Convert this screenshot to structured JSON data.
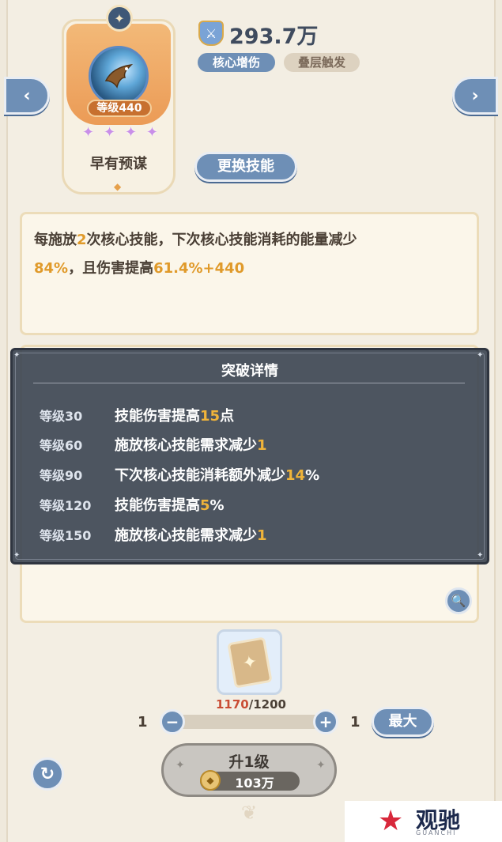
{
  "nav": {
    "prev_icon": "chevron-left-icon",
    "next_icon": "chevron-right-icon",
    "prev_glyph": "‹",
    "next_glyph": "›"
  },
  "skill": {
    "level_label": "等级440",
    "stars": 4,
    "name": "早有预谋",
    "icon": "eagle-icon"
  },
  "power": {
    "value": "293.7万",
    "icon": "shield-sword-icon"
  },
  "tags": [
    "核心增伤",
    "叠层触发"
  ],
  "change_skill_label": "更换技能",
  "description": {
    "p1": "每施放",
    "n1": "2",
    "p2": "次核心技能，下次核心技能消耗的能量减少",
    "n2": "84%",
    "p3": "，且伤害提高",
    "n3": "61.4%+440"
  },
  "breakthrough": {
    "title": "突破详情",
    "rows": [
      {
        "level": "等级30",
        "text": "技能伤害提高",
        "num": "15",
        "suffix": "点"
      },
      {
        "level": "等级60",
        "text": "施放核心技能需求减少",
        "num": "1",
        "suffix": ""
      },
      {
        "level": "等级90",
        "text": "下次核心技能消耗额外减少",
        "num": "14",
        "suffix": "%"
      },
      {
        "level": "等级120",
        "text": "技能伤害提高",
        "num": "5",
        "suffix": "%"
      },
      {
        "level": "等级150",
        "text": "施放核心技能需求减少",
        "num": "1",
        "suffix": ""
      }
    ]
  },
  "material": {
    "have": "1170",
    "sep": "/",
    "need": "1200"
  },
  "quantity": {
    "min": "1",
    "max": "1",
    "max_button": "最大",
    "minus": "−",
    "plus": "+"
  },
  "upgrade": {
    "label": "升1级",
    "cost": "103万"
  },
  "icons": {
    "zoom": "zoom-icon",
    "refresh": "refresh-icon",
    "coin": "coin-icon"
  },
  "watermark": {
    "text": "观驰",
    "sub": "GUANCHI"
  },
  "colors": {
    "accent_blue": "#6e8fb6",
    "highlight_orange": "#e09a2a",
    "popup_bg": "#3e4654"
  }
}
